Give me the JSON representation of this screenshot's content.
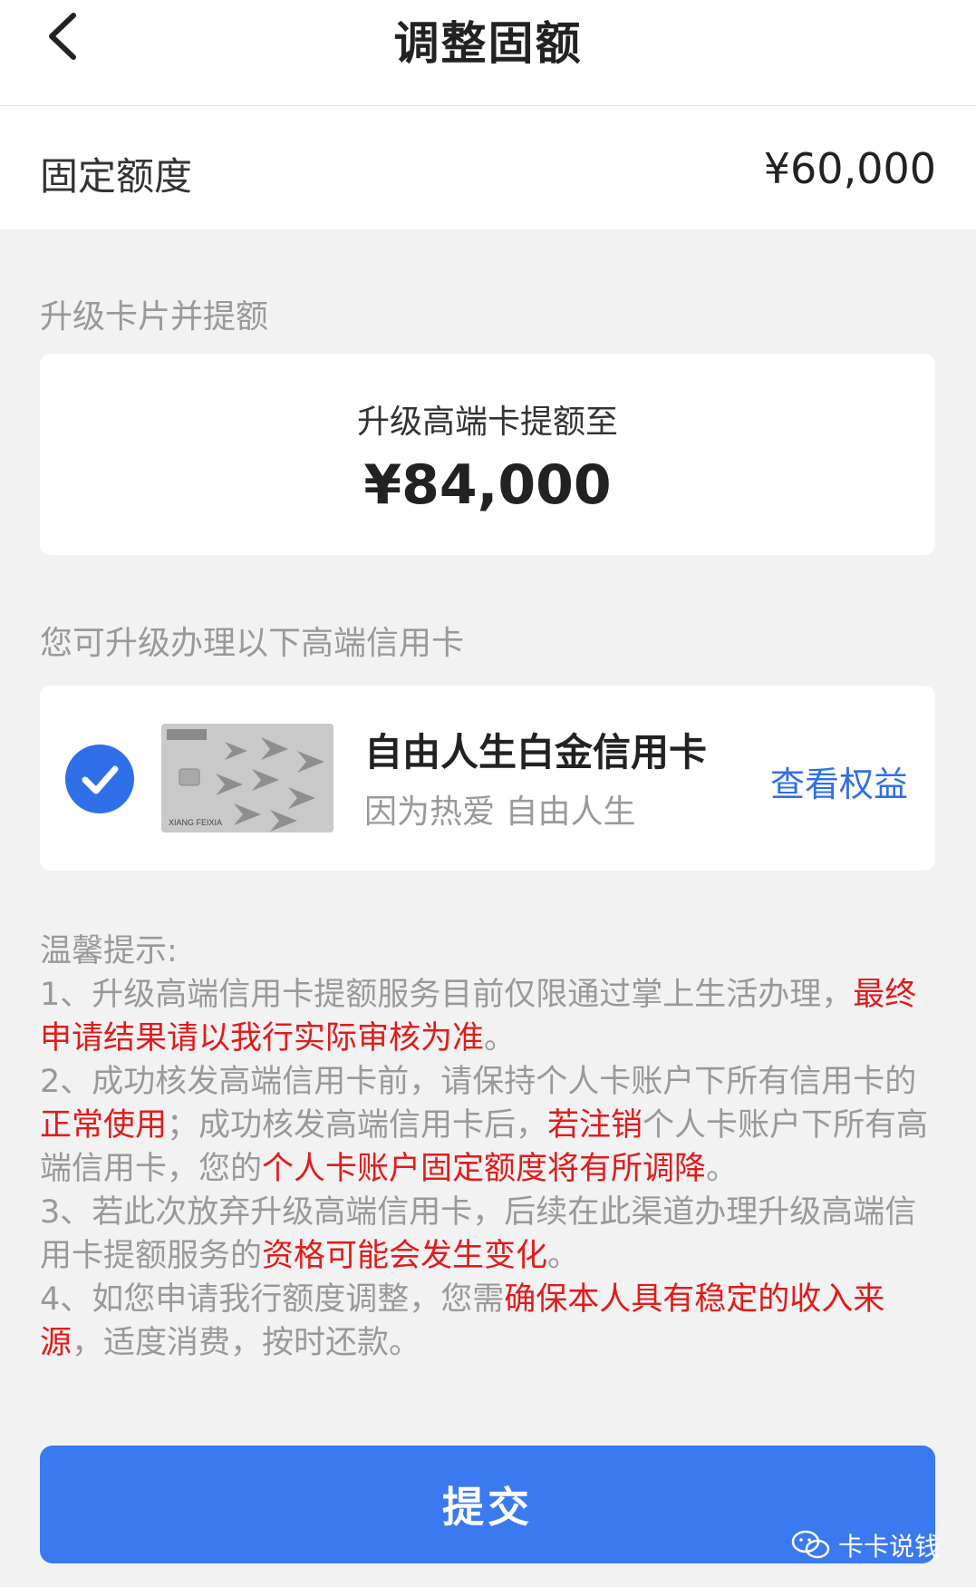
{
  "header": {
    "title": "调整固额",
    "back_icon": "chevron-left-icon"
  },
  "fixed_limit": {
    "label": "固定额度",
    "value": "¥60,000"
  },
  "upgrade_section": {
    "label": "升级卡片并提额",
    "subtitle": "升级高端卡提额至",
    "amount": "¥84,000"
  },
  "card_section": {
    "label": "您可升级办理以下高端信用卡",
    "card": {
      "selected": true,
      "name": "自由人生白金信用卡",
      "slogan": "因为热爱 自由人生",
      "benefits_link": "查看权益",
      "thumb_text": "XIANG FEIXIA"
    }
  },
  "tips": {
    "title": "温馨提示:",
    "items": [
      {
        "t1": "1、升级高端信用卡提额服务目前仅限通过掌上生活办理，",
        "r1": "最终申请结果请以我行实际审核为准",
        "t2": "。"
      },
      {
        "t1": "2、成功核发高端信用卡前，请保持个人卡账户下所有信用卡的",
        "r1": "正常使用",
        "t2": "；成功核发高端信用卡后，",
        "r2": "若注销",
        "t3": "个人卡账户下所有高端信用卡，您的",
        "r3": "个人卡账户固定额度将有所调降",
        "t4": "。"
      },
      {
        "t1": "3、若此次放弃升级高端信用卡，后续在此渠道办理升级高端信用卡提额服务的",
        "r1": "资格可能会发生变化",
        "t2": "。"
      },
      {
        "t1": "4、如您申请我行额度调整，您需",
        "r1": "确保本人具有稳定的收入来源",
        "t2": "，适度消费，按时还款。"
      }
    ]
  },
  "submit": {
    "label": "提交"
  },
  "watermark": {
    "text": "卡卡说钱",
    "icon": "wechat-icon"
  },
  "colors": {
    "accent": "#2f6fe8",
    "button": "#3b79f0",
    "highlight_red": "#e21b1b",
    "muted_text": "#999999"
  }
}
